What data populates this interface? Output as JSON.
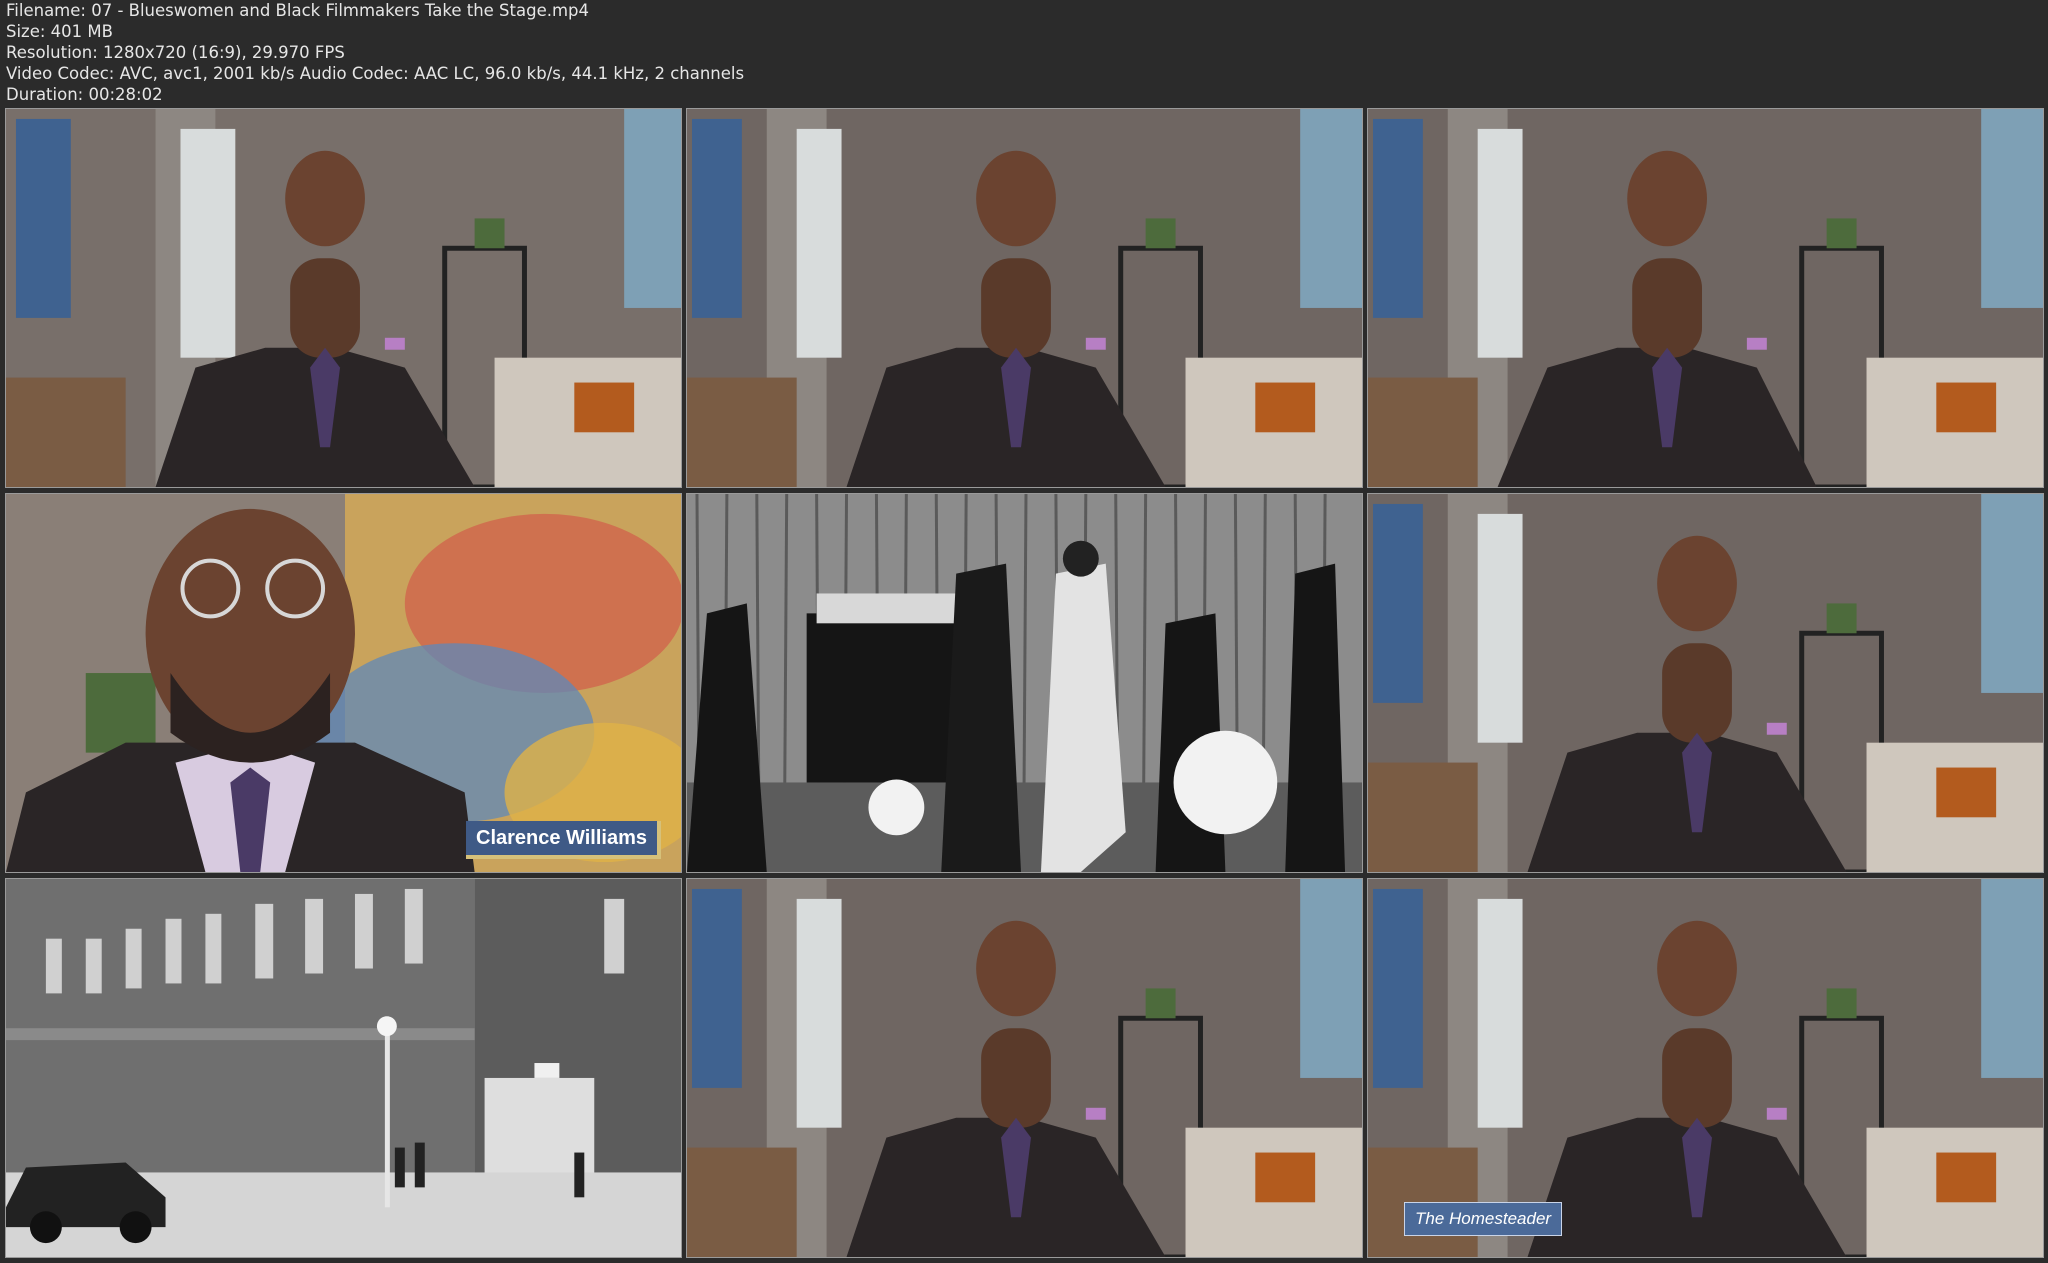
{
  "file_info": {
    "filename_line": "Filename: 07 - Blueswomen and Black Filmmakers Take the Stage.mp4",
    "size_line": "Size: 401 MB",
    "resolution_line": "Resolution: 1280x720 (16:9), 29.970 FPS",
    "codec_line": "Video Codec: AVC, avc1, 2001 kb/s Audio Codec: AAC LC, 96.0 kb/s, 44.1 kHz, 2 channels",
    "duration_line": "Duration: 00:28:02"
  },
  "thumbnails": [
    {
      "scene": "host-studio-wide"
    },
    {
      "scene": "host-studio-wide"
    },
    {
      "scene": "host-studio-wide"
    },
    {
      "scene": "host-closeup",
      "caption": "Clarence Williams"
    },
    {
      "scene": "archival-band-photo"
    },
    {
      "scene": "host-studio-wide"
    },
    {
      "scene": "archival-street-photo"
    },
    {
      "scene": "host-studio-wide"
    },
    {
      "scene": "host-studio-wide",
      "caption": "The Homesteader"
    }
  ],
  "colors": {
    "background": "#2b2b2b",
    "text": "#e6e6e6",
    "caption_bg": "#3f5a86",
    "caption_accent": "#d6c17a"
  }
}
